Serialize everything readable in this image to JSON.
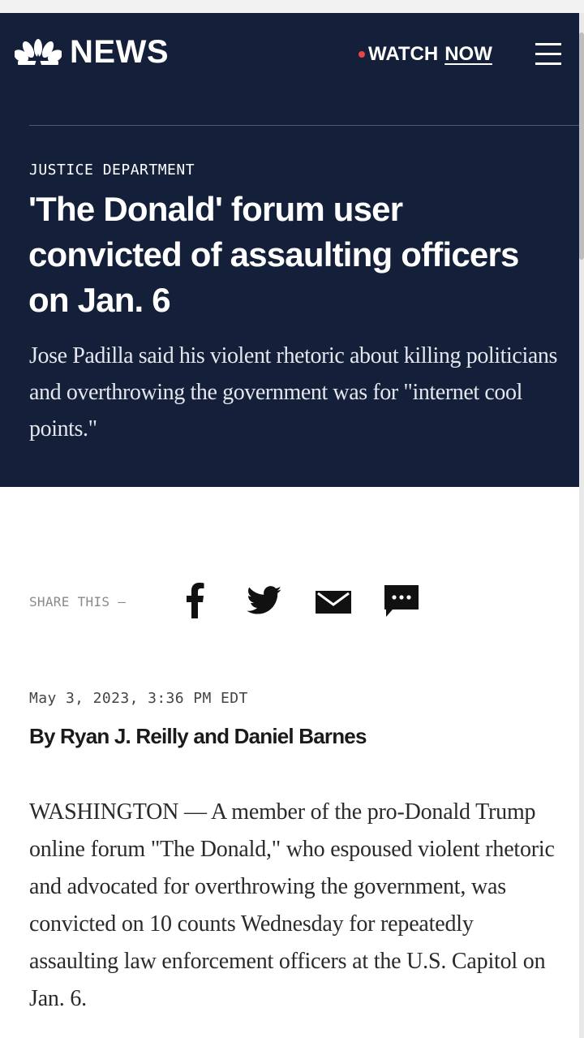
{
  "header": {
    "logo_text": "NEWS",
    "watch_label": "WATCH",
    "now_label": "NOW",
    "live_dot_color": "#e84545",
    "background": "#142039"
  },
  "article": {
    "category": "JUSTICE DEPARTMENT",
    "headline": "'The Donald' forum user convicted of assaulting officers on Jan. 6",
    "dek": "Jose Padilla said his violent rhetoric about killing politicians and overthrowing the government was for \"internet cool points.\"",
    "share_label": "SHARE THIS —",
    "share_buttons": [
      "facebook-icon",
      "twitter-icon",
      "email-icon",
      "comment-icon"
    ],
    "date": "May 3, 2023, 3:36 PM EDT",
    "byline": "By Ryan J. Reilly and Daniel Barnes",
    "body": "WASHINGTON — A member of the pro-Donald Trump online forum \"The Donald,\" who espoused violent rhetoric and advocated for overthrowing the government, was convicted on 10 counts Wednesday for repeatedly assaulting law enforcement officers at the U.S. Capitol on Jan. 6."
  }
}
